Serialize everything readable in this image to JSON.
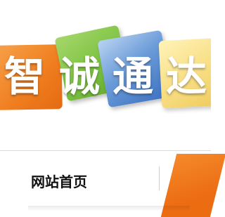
{
  "logo": {
    "characters": [
      "智",
      "诚",
      "通",
      "达"
    ],
    "tile_colors": [
      "#ef7d1f",
      "#7cc242",
      "#6b9bd8",
      "#f8df86"
    ],
    "text_color": "#ffffff"
  },
  "nav": {
    "home_label": "网站首页",
    "accent_color": "#ec6c12"
  }
}
